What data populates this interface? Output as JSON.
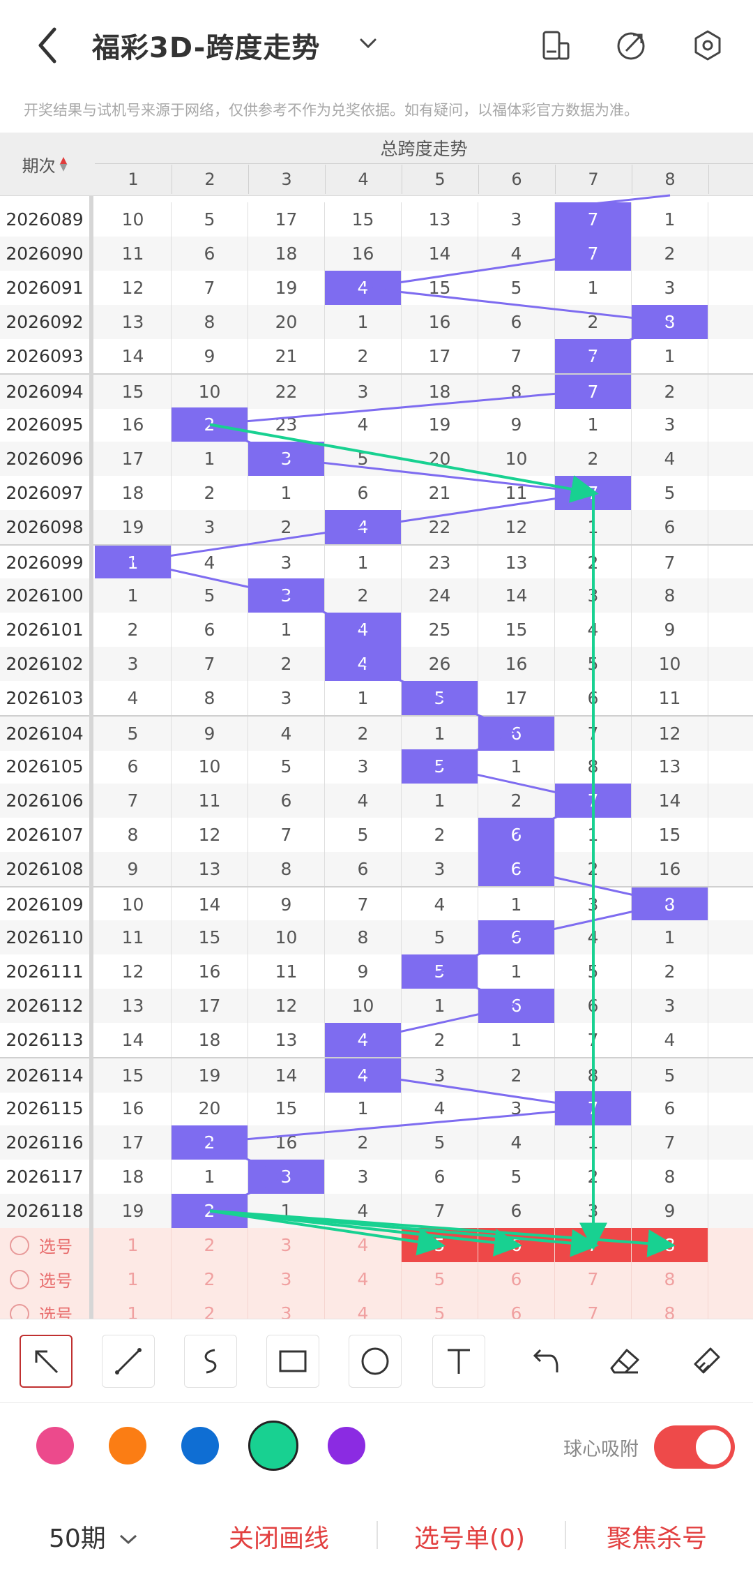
{
  "header": {
    "title": "福彩3D-跨度走势",
    "disclaimer": "开奖结果与试机号来源于网络，仅供参考不作为兑奖依据。如有疑问，以福体彩官方数据为准。"
  },
  "table": {
    "period_header": "期次",
    "group_header": "总跨度走势",
    "columns": [
      "1",
      "2",
      "3",
      "4",
      "5",
      "6",
      "7",
      "8"
    ],
    "rows": [
      {
        "period": "2026089",
        "cells": [
          "10",
          "5",
          "17",
          "15",
          "13",
          "3",
          "7",
          "1"
        ],
        "hit": 7
      },
      {
        "period": "2026090",
        "cells": [
          "11",
          "6",
          "18",
          "16",
          "14",
          "4",
          "7",
          "2"
        ],
        "hit": 7
      },
      {
        "period": "2026091",
        "cells": [
          "12",
          "7",
          "19",
          "4",
          "15",
          "5",
          "1",
          "3"
        ],
        "hit": 4
      },
      {
        "period": "2026092",
        "cells": [
          "13",
          "8",
          "20",
          "1",
          "16",
          "6",
          "2",
          "8"
        ],
        "hit": 8
      },
      {
        "period": "2026093",
        "cells": [
          "14",
          "9",
          "21",
          "2",
          "17",
          "7",
          "7",
          "1"
        ],
        "hit": 7
      },
      {
        "period": "2026094",
        "cells": [
          "15",
          "10",
          "22",
          "3",
          "18",
          "8",
          "7",
          "2"
        ],
        "hit": 7
      },
      {
        "period": "2026095",
        "cells": [
          "16",
          "2",
          "23",
          "4",
          "19",
          "9",
          "1",
          "3"
        ],
        "hit": 2
      },
      {
        "period": "2026096",
        "cells": [
          "17",
          "1",
          "3",
          "5",
          "20",
          "10",
          "2",
          "4"
        ],
        "hit": 3
      },
      {
        "period": "2026097",
        "cells": [
          "18",
          "2",
          "1",
          "6",
          "21",
          "11",
          "7",
          "5"
        ],
        "hit": 7
      },
      {
        "period": "2026098",
        "cells": [
          "19",
          "3",
          "2",
          "4",
          "22",
          "12",
          "1",
          "6"
        ],
        "hit": 4
      },
      {
        "period": "2026099",
        "cells": [
          "1",
          "4",
          "3",
          "1",
          "23",
          "13",
          "2",
          "7"
        ],
        "hit": 1
      },
      {
        "period": "2026100",
        "cells": [
          "1",
          "5",
          "3",
          "2",
          "24",
          "14",
          "3",
          "8"
        ],
        "hit": 3
      },
      {
        "period": "2026101",
        "cells": [
          "2",
          "6",
          "1",
          "4",
          "25",
          "15",
          "4",
          "9"
        ],
        "hit": 4
      },
      {
        "period": "2026102",
        "cells": [
          "3",
          "7",
          "2",
          "4",
          "26",
          "16",
          "5",
          "10"
        ],
        "hit": 4
      },
      {
        "period": "2026103",
        "cells": [
          "4",
          "8",
          "3",
          "1",
          "5",
          "17",
          "6",
          "11"
        ],
        "hit": 5
      },
      {
        "period": "2026104",
        "cells": [
          "5",
          "9",
          "4",
          "2",
          "1",
          "6",
          "7",
          "12"
        ],
        "hit": 6
      },
      {
        "period": "2026105",
        "cells": [
          "6",
          "10",
          "5",
          "3",
          "5",
          "1",
          "8",
          "13"
        ],
        "hit": 5
      },
      {
        "period": "2026106",
        "cells": [
          "7",
          "11",
          "6",
          "4",
          "1",
          "2",
          "7",
          "14"
        ],
        "hit": 7
      },
      {
        "period": "2026107",
        "cells": [
          "8",
          "12",
          "7",
          "5",
          "2",
          "6",
          "1",
          "15"
        ],
        "hit": 6
      },
      {
        "period": "2026108",
        "cells": [
          "9",
          "13",
          "8",
          "6",
          "3",
          "6",
          "2",
          "16"
        ],
        "hit": 6
      },
      {
        "period": "2026109",
        "cells": [
          "10",
          "14",
          "9",
          "7",
          "4",
          "1",
          "3",
          "8"
        ],
        "hit": 8
      },
      {
        "period": "2026110",
        "cells": [
          "11",
          "15",
          "10",
          "8",
          "5",
          "6",
          "4",
          "1"
        ],
        "hit": 6
      },
      {
        "period": "2026111",
        "cells": [
          "12",
          "16",
          "11",
          "9",
          "5",
          "1",
          "5",
          "2"
        ],
        "hit": 5
      },
      {
        "period": "2026112",
        "cells": [
          "13",
          "17",
          "12",
          "10",
          "1",
          "6",
          "6",
          "3"
        ],
        "hit": 6
      },
      {
        "period": "2026113",
        "cells": [
          "14",
          "18",
          "13",
          "4",
          "2",
          "1",
          "7",
          "4"
        ],
        "hit": 4
      },
      {
        "period": "2026114",
        "cells": [
          "15",
          "19",
          "14",
          "4",
          "3",
          "2",
          "8",
          "5"
        ],
        "hit": 4
      },
      {
        "period": "2026115",
        "cells": [
          "16",
          "20",
          "15",
          "1",
          "4",
          "3",
          "7",
          "6"
        ],
        "hit": 7
      },
      {
        "period": "2026116",
        "cells": [
          "17",
          "2",
          "16",
          "2",
          "5",
          "4",
          "1",
          "7"
        ],
        "hit": 2
      },
      {
        "period": "2026117",
        "cells": [
          "18",
          "1",
          "3",
          "3",
          "6",
          "5",
          "2",
          "8"
        ],
        "hit": 3
      },
      {
        "period": "2026118",
        "cells": [
          "19",
          "2",
          "1",
          "4",
          "7",
          "6",
          "3",
          "9"
        ],
        "hit": 2
      }
    ],
    "select_rows": [
      {
        "label": "选号",
        "cells": [
          "1",
          "2",
          "3",
          "4",
          "5",
          "6",
          "7",
          "8"
        ],
        "picked": [
          5,
          6,
          7,
          8
        ]
      },
      {
        "label": "选号",
        "cells": [
          "1",
          "2",
          "3",
          "4",
          "5",
          "6",
          "7",
          "8"
        ],
        "picked": []
      },
      {
        "label": "选号",
        "cells": [
          "1",
          "2",
          "3",
          "4",
          "5",
          "6",
          "7",
          "8"
        ],
        "picked": []
      }
    ]
  },
  "tools": [
    "arrow-tool",
    "line-tool",
    "curve-tool",
    "rectangle-tool",
    "circle-tool",
    "text-tool",
    "undo-tool",
    "eraser-tool",
    "clear-tool"
  ],
  "palette": {
    "colors": [
      "#ec4a8c",
      "#fb7d14",
      "#0f6ed3",
      "#18d191",
      "#8b2be2"
    ],
    "selected": "#18d191",
    "snap_label": "球心吸附",
    "snap_on": true
  },
  "bottom": {
    "period_select": "50期",
    "close_lines": "关闭画线",
    "selection_list": "选号单(0)",
    "focus_kill": "聚焦杀号"
  }
}
